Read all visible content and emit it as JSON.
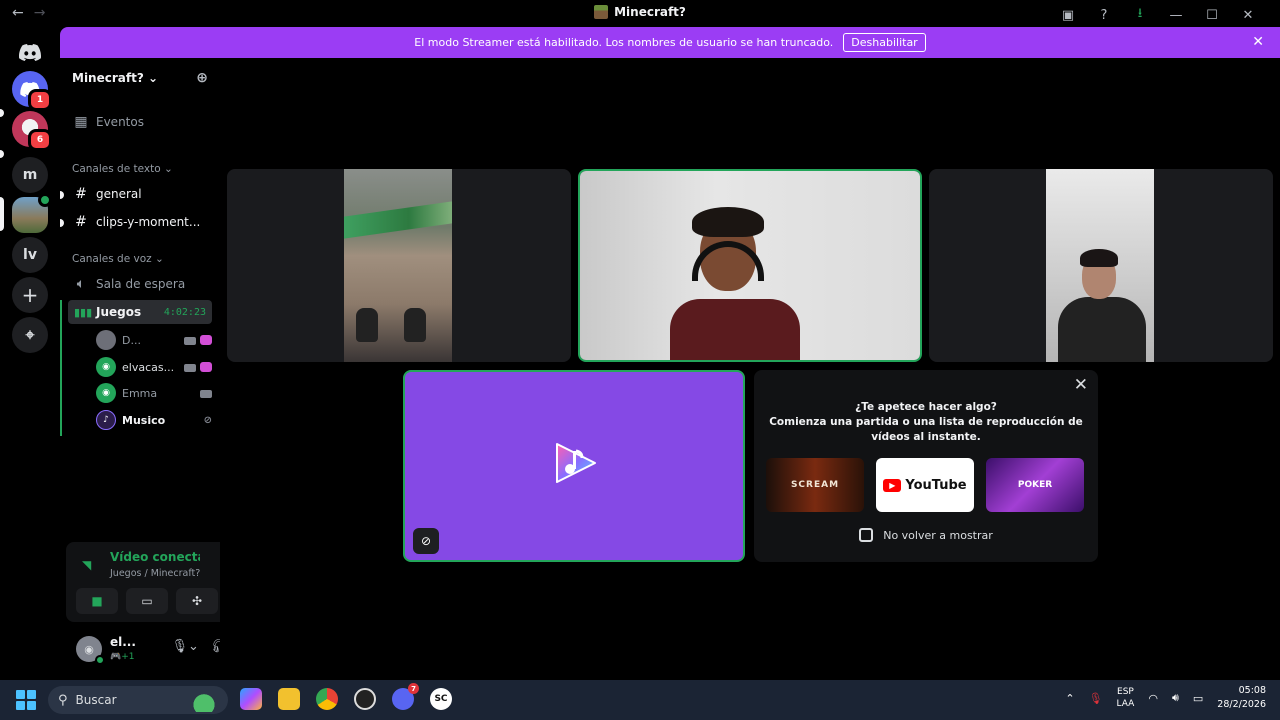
{
  "window": {
    "title": "Minecraft?",
    "nav_back": "←",
    "nav_forward": "→",
    "controls": [
      "▣",
      "?",
      "⭳",
      "—",
      "☐",
      "✕"
    ]
  },
  "servers": {
    "home_glyph": "◉",
    "items": [
      {
        "name": "discord-server",
        "badge": "1"
      },
      {
        "name": "ghost-server",
        "badge": "6"
      },
      {
        "name": "m-server",
        "letter": "m"
      },
      {
        "name": "minecraft-server"
      },
      {
        "name": "lv-server",
        "letter": "lv"
      }
    ],
    "add_glyph": "+",
    "discover_glyph": "⌖"
  },
  "banner": {
    "message": "El modo Streamer está habilitado. Los nombres de usuario se han truncado.",
    "button": "Deshabilitar",
    "close": "✕"
  },
  "sidebar": {
    "guild_name": "Minecraft? ⌄",
    "invite_glyph": "⊕",
    "events": "Eventos",
    "text_category": "Canales de texto ⌄",
    "text_channels": [
      "general",
      "clips-y-moment..."
    ],
    "voice_category": "Canales de voz ⌄",
    "voice_channels": [
      {
        "name": "Sala de espera"
      },
      {
        "name": "Juegos",
        "time": "4:02:23"
      }
    ],
    "voice_users": [
      {
        "name": "D..."
      },
      {
        "name": "elvacas..."
      },
      {
        "name": "Emma"
      },
      {
        "name": "Musico"
      }
    ]
  },
  "voice_panel": {
    "title": "Vídeo conectado",
    "subtitle": "Juegos / Minecraft?"
  },
  "user": {
    "name": "el...",
    "status": "🎮+1"
  },
  "activity_promo": {
    "headline_1": "¿Te apetece hacer algo?",
    "headline_2": "Comienza una partida o una lista de reproducción de",
    "headline_3": "vídeos al instante.",
    "cards": [
      "SCREAM",
      "YouTube",
      "POKER"
    ],
    "checkbox_label": "No volver a mostrar",
    "close": "✕"
  },
  "taskbar": {
    "search_placeholder": "Buscar",
    "discord_badge": "7",
    "lang_1": "ESP",
    "lang_2": "LAA",
    "time": "05:08",
    "date": "28/2/2026"
  },
  "colors": {
    "accent": "#9b3df4",
    "green": "#23a55a",
    "activity_bg": "#8549e5",
    "blurple": "#5865f2"
  }
}
